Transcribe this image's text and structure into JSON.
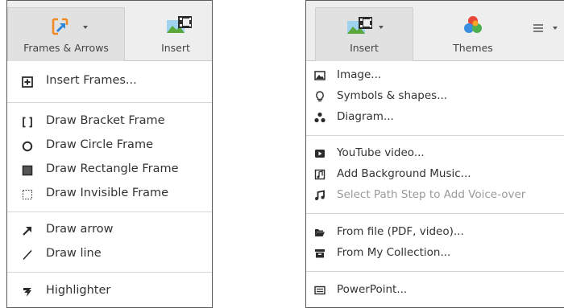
{
  "left_panel": {
    "toolbar": {
      "frames_arrows_label": "Frames & Arrows",
      "insert_label": "Insert"
    },
    "menu": {
      "insert_frames": "Insert Frames...",
      "bracket": "Draw Bracket Frame",
      "circle": "Draw Circle Frame",
      "rectangle": "Draw Rectangle Frame",
      "invisible": "Draw Invisible Frame",
      "arrow": "Draw arrow",
      "line": "Draw line",
      "highlighter": "Highlighter"
    }
  },
  "right_panel": {
    "toolbar": {
      "insert_label": "Insert",
      "themes_label": "Themes"
    },
    "menu": {
      "image": "Image...",
      "symbols": "Symbols & shapes...",
      "diagram": "Diagram...",
      "youtube": "YouTube video...",
      "music": "Add Background Music...",
      "voiceover": "Select Path Step to Add Voice-over",
      "from_file": "From file (PDF, video)...",
      "collection": "From My Collection...",
      "powerpoint": "PowerPoint..."
    }
  },
  "colors": {
    "icon_dark": "#2b2b2b",
    "frames_icon_orange": "#f08a24",
    "frames_icon_blue": "#2f86d6",
    "insert_icon_green": "#5aa83c",
    "insert_icon_sky": "#9fd3f0",
    "themes_red": "#e8483a",
    "themes_orange": "#f6a623",
    "themes_blue": "#3b8fe0",
    "themes_green": "#4caf50",
    "disabled_text": "#9a9a9a"
  }
}
